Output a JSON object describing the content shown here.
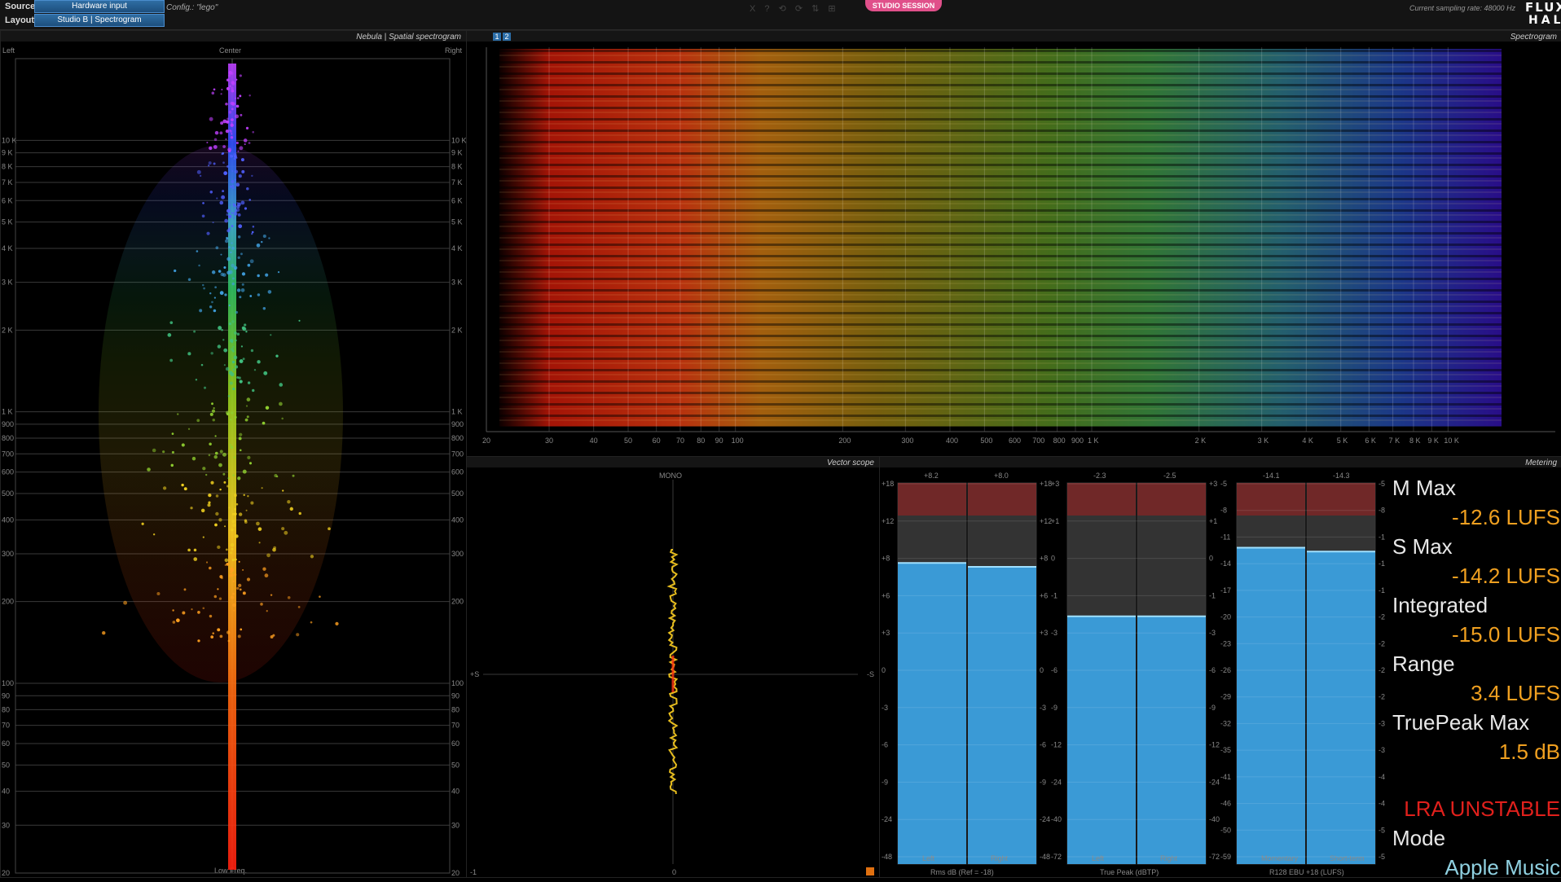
{
  "topbar": {
    "source_label": "Source",
    "source_value": "Hardware input",
    "layout_label": "Layout",
    "layout_value": "Studio B | Spectrogram",
    "config": "Config.: \"lego\"",
    "toolbar_ghost": "X  ?  ⟲  ⟳  ⇅  ⊞",
    "studio_session": "STUDIO SESSION",
    "sampling_rate": "Current sampling rate: 48000 Hz",
    "logo_top": "FLUX:",
    "logo_bottom": "HAL"
  },
  "nebula": {
    "title": "Nebula | Spatial spectrogram",
    "left": "Left",
    "center": "Center",
    "right": "Right",
    "bottom": "Low Freq.",
    "freq_labels": [
      "10 K",
      "9 K",
      "8 K",
      "7 K",
      "6 K",
      "5 K",
      "4 K",
      "3 K",
      "2 K",
      "1 K",
      "900",
      "800",
      "700",
      "600",
      "500",
      "400",
      "300",
      "200",
      "100",
      "90",
      "80",
      "70",
      "60",
      "50",
      "40",
      "30",
      "20"
    ]
  },
  "spectrogram": {
    "title": "Spectrogram",
    "tabs": [
      "1",
      "2"
    ],
    "x_labels": [
      "20",
      "30",
      "40",
      "50",
      "60",
      "70",
      "80",
      "90",
      "100",
      "200",
      "300",
      "400",
      "500",
      "600",
      "700",
      "800",
      "900",
      "1 K",
      "2 K",
      "3 K",
      "4 K",
      "5 K",
      "6 K",
      "7 K",
      "8 K",
      "9 K",
      "10 K"
    ]
  },
  "vectorscope": {
    "title": "Vector scope",
    "mono": "MONO",
    "plus_s": "+S",
    "minus_s": "-S",
    "bottom_left": "-1",
    "bottom_center": "0"
  },
  "metering": {
    "title": "Metering",
    "rms": {
      "peak_left": "+8.2",
      "peak_right": "+8.0",
      "ch_left": "Left",
      "ch_right": "Right",
      "footer": "Rms dB (Ref = -18)",
      "scale": [
        "+18",
        "+12",
        "+8",
        "+6",
        "+3",
        "0",
        "-3",
        "-6",
        "-9",
        "-24",
        "-48"
      ],
      "level_left": 0.79,
      "level_right": 0.78
    },
    "truepeak": {
      "peak_left": "-2.3",
      "peak_right": "-2.5",
      "ch_left": "Left",
      "ch_right": "Right",
      "footer": "True Peak (dBTP)",
      "scale": [
        "+3",
        "+1",
        "0",
        "-1",
        "-3",
        "-6",
        "-9",
        "-12",
        "-24",
        "-40",
        "-72"
      ],
      "level_left": 0.65,
      "level_right": 0.65
    },
    "loudness": {
      "peak_left": "-14.1",
      "peak_right": "-14.3",
      "ch_left": "Momentary",
      "ch_right": "Short-term",
      "footer": "R128 EBU +18 (LUFS)",
      "scale": [
        "-5",
        "-8",
        "-11",
        "-14",
        "-17",
        "-20",
        "-23",
        "-26",
        "-29",
        "-32",
        "-35",
        "-41",
        "-46",
        "-50",
        "-59"
      ],
      "level_left": 0.83,
      "level_right": 0.82
    },
    "readouts": {
      "m_max_label": "M Max",
      "m_max_value": "-12.6 LUFS",
      "s_max_label": "S Max",
      "s_max_value": "-14.2 LUFS",
      "integrated_label": "Integrated",
      "integrated_value": "-15.0 LUFS",
      "range_label": "Range",
      "range_value": "3.4 LUFS",
      "truepeak_label": "TruePeak Max",
      "truepeak_value": "1.5 dB",
      "lra_status": "LRA UNSTABLE",
      "mode_label": "Mode",
      "mode_value": "Apple Music"
    }
  },
  "colors": {
    "accent_blue": "#4fb3e8",
    "value_orange": "#f0a020",
    "warning_red": "#e0201c",
    "mode_cyan": "#8fd0e0",
    "studio_pink": "#e0508a"
  }
}
